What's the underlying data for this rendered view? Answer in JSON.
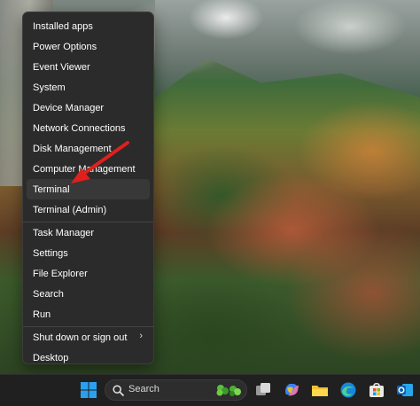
{
  "context_menu": {
    "items": [
      {
        "label": "Installed apps"
      },
      {
        "label": "Power Options"
      },
      {
        "label": "Event Viewer"
      },
      {
        "label": "System"
      },
      {
        "label": "Device Manager"
      },
      {
        "label": "Network Connections"
      },
      {
        "label": "Disk Management"
      },
      {
        "label": "Computer Management"
      },
      {
        "label": "Terminal",
        "highlighted": true
      },
      {
        "label": "Terminal (Admin)"
      },
      {
        "label": "Task Manager"
      },
      {
        "label": "Settings"
      },
      {
        "label": "File Explorer"
      },
      {
        "label": "Search"
      },
      {
        "label": "Run"
      },
      {
        "label": "Shut down or sign out",
        "has_submenu": true
      },
      {
        "label": "Desktop"
      }
    ],
    "submenu_indicator": "›"
  },
  "taskbar": {
    "search_label": "Search",
    "icons": [
      "windows-start-icon",
      "search-icon",
      "task-view-icon",
      "copilot-icon",
      "file-explorer-icon",
      "edge-icon",
      "microsoft-store-icon",
      "outlook-icon"
    ]
  },
  "colors": {
    "menu_bg": "#2b2b2b",
    "menu_highlight": "#383838",
    "taskbar_bg": "#202020",
    "arrow_red": "#e0201c",
    "windows_blue": "#2aa0f0"
  }
}
